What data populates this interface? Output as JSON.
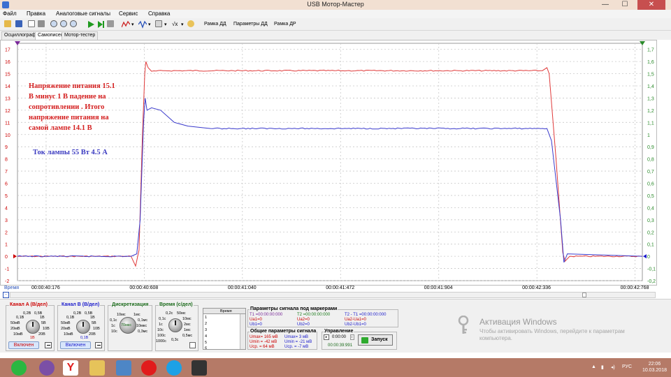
{
  "window": {
    "title": "USB Мотор-Мастер",
    "minimize_glyph": "—",
    "maximize_glyph": "☐",
    "close_glyph": "✕"
  },
  "menu": [
    "Файл",
    "Правка",
    "Аналоговые сигналы",
    "Сервис",
    "Справка"
  ],
  "toolbar": {
    "icons": [
      "open-folder-icon",
      "save-icon",
      "page-icon",
      "print-icon",
      "zoom-in-icon",
      "zoom-out-icon",
      "zoom-fit-icon",
      "play-icon",
      "play-step-icon",
      "stop-icon",
      "scope-marker-icon",
      "waveform-icon",
      "grid-icon",
      "formula-icon",
      "sound-icon"
    ],
    "formula_label": "√x",
    "frame_dd": "Рамка ДД",
    "params_dd": "Параметры ДД",
    "frame_dr": "Рамка ДР"
  },
  "tabs": [
    "Осциллограф",
    "Самописец",
    "Мотор-тестер"
  ],
  "active_tab": 1,
  "annotations": {
    "red_text": [
      "Напряжение питания 15.1",
      "В  минус 1 В падение на",
      "сопротивлении . Итого",
      "напряжение питания на",
      "самой лампе 14.1 В"
    ],
    "blue_text": "Ток лампы 55 Вт 4.5 А"
  },
  "time_axis": {
    "label": "Время",
    "btn_minus": "-",
    "btn_plus": "+"
  },
  "chart_data": {
    "type": "line",
    "title": "",
    "xlabel": "Время",
    "x_ticks": [
      "00:00:40:176",
      "00:00:40:608",
      "00:00:41:040",
      "00:00:41:472",
      "00:00:41:904",
      "00:00:42:336",
      "00:00:42:768"
    ],
    "x_range_s": [
      40.05,
      42.8
    ],
    "y_left": {
      "range": [
        -2,
        17.5
      ],
      "ticks": [
        "-2",
        "-1",
        "0",
        "1",
        "2",
        "3",
        "4",
        "5",
        "6",
        "7",
        "8",
        "9",
        "10",
        "11",
        "12",
        "13",
        "14",
        "15",
        "16",
        "17"
      ],
      "unit": "В",
      "color": "#cc0000"
    },
    "y_right": {
      "range": [
        -0.2,
        1.75
      ],
      "ticks": [
        "-0,2",
        "-0,1",
        "0",
        "0,1",
        "0,2",
        "0,3",
        "0,4",
        "0,5",
        "0,6",
        "0,7",
        "0,8",
        "0,9",
        "1",
        "1,1",
        "1,2",
        "1,3",
        "1,4",
        "1,5",
        "1,6",
        "1,7"
      ],
      "color": "#2a8a2a"
    },
    "grid": true,
    "series": [
      {
        "color": "#e03a3a",
        "axis": "left",
        "points": [
          [
            40.05,
            0.0
          ],
          [
            40.55,
            0.0
          ],
          [
            40.57,
            -0.8
          ],
          [
            40.585,
            0.5
          ],
          [
            40.6,
            10.0
          ],
          [
            40.61,
            15.0
          ],
          [
            40.615,
            16.0
          ],
          [
            40.625,
            15.5
          ],
          [
            40.64,
            15.2
          ],
          [
            40.7,
            15.25
          ],
          [
            41.0,
            15.25
          ],
          [
            41.5,
            15.25
          ],
          [
            42.0,
            15.25
          ],
          [
            42.36,
            15.25
          ],
          [
            42.38,
            15.5
          ],
          [
            42.39,
            15.0
          ],
          [
            42.42,
            8.0
          ],
          [
            42.45,
            0.3
          ],
          [
            42.46,
            -0.4
          ],
          [
            42.48,
            0.0
          ],
          [
            42.8,
            0.0
          ]
        ]
      },
      {
        "color": "#3a3acc",
        "axis": "right",
        "points": [
          [
            40.05,
            0.0
          ],
          [
            40.55,
            0.0
          ],
          [
            40.575,
            0.02
          ],
          [
            40.59,
            0.3
          ],
          [
            40.605,
            1.1
          ],
          [
            40.612,
            1.3
          ],
          [
            40.62,
            1.2
          ],
          [
            40.64,
            1.22
          ],
          [
            40.68,
            1.2
          ],
          [
            40.74,
            1.1
          ],
          [
            40.8,
            1.07
          ],
          [
            40.9,
            1.05
          ],
          [
            41.0,
            1.05
          ],
          [
            41.5,
            1.05
          ],
          [
            42.0,
            1.05
          ],
          [
            42.38,
            1.05
          ],
          [
            42.4,
            0.95
          ],
          [
            42.44,
            0.3
          ],
          [
            42.455,
            -0.05
          ],
          [
            42.47,
            0.02
          ],
          [
            42.8,
            0.0
          ]
        ]
      }
    ]
  },
  "panel": {
    "channel_a": {
      "title": "Канал A (В/дел)",
      "scales": [
        "0,2В",
        "0,5В",
        "1В",
        "2В",
        "5В",
        "10В",
        "20В",
        "50мВ",
        "20мВ",
        "10мВ",
        "0,1В",
        "1В"
      ],
      "button": "Включен",
      "color": "#cc0000"
    },
    "channel_b": {
      "title": "Канал B (В/дел)",
      "scales": [
        "0,2В",
        "0,5В",
        "1В",
        "2В",
        "5В",
        "10В",
        "20В",
        "50мВ",
        "20мВ",
        "10мВ",
        "0,1В",
        "0,1В"
      ],
      "button": "Включен",
      "color": "#1a1acc"
    },
    "discretization": {
      "title": "Дискретизация",
      "scales": [
        "10мс",
        "1мс",
        "0,1с",
        "0,1мс",
        "1с",
        "10мкс",
        "10с",
        "1мкс",
        "70мкс",
        "0,3мс"
      ],
      "value": "70мкс",
      "color": "#1a6a1a"
    },
    "time_div": {
      "title": "Время (с/дел)",
      "scales": [
        "0,2с",
        "50мс",
        "0,1с",
        "10мс",
        "1с",
        "2мс",
        "10с",
        "1мс",
        "100с",
        "0,5мс",
        "1000с",
        "0,3с"
      ],
      "color": "#1a6a1a"
    },
    "marker_table": {
      "header": "Время",
      "rows": [
        "1",
        "2",
        "3",
        "4",
        "5",
        "6"
      ]
    },
    "marker_params": {
      "title": "Параметры сигнала под маркерами",
      "t1": "T1 =00:00:00:000",
      "ua1": "Ua1=0",
      "ub1": "Ub1=0",
      "t2": "T2 =00:00:00:000",
      "ua2": "Ua2=0",
      "ub2": "Ub2=0",
      "dt": "T2 - T1 =00:00:00:000",
      "dua": "Ua2-Ua1=0",
      "dub": "Ub2-Ub1=0"
    },
    "general_params": {
      "title": "Общие параметры сигнала",
      "umax_a": "Umax=  165 мВ",
      "umin_a": "Umin =  -42 мВ",
      "ucp_a": "Ucр. =   64 мВ",
      "umax_b": "Umax=   3 мВ",
      "umin_b": "Umin =  -21 мВ",
      "ucp_b": "Ucр. =   -7 мВ"
    },
    "control": {
      "title": "Управление",
      "time_value": "0:00:00",
      "elapsed": "00:00:39:991",
      "start": "Запуск"
    }
  },
  "watermark": {
    "title": "Активация Windows",
    "text": "Чтобы активировать Windows, перейдите к параметрам компьютера."
  },
  "taskbar": {
    "apps": [
      "whatsapp-icon",
      "viber-icon",
      "yandex-icon",
      "explorer-icon",
      "network-icon",
      "opera-icon",
      "skype-icon",
      "motormaster-icon"
    ],
    "lang": "РУС",
    "time": "22:06",
    "date": "10.03.2018"
  }
}
